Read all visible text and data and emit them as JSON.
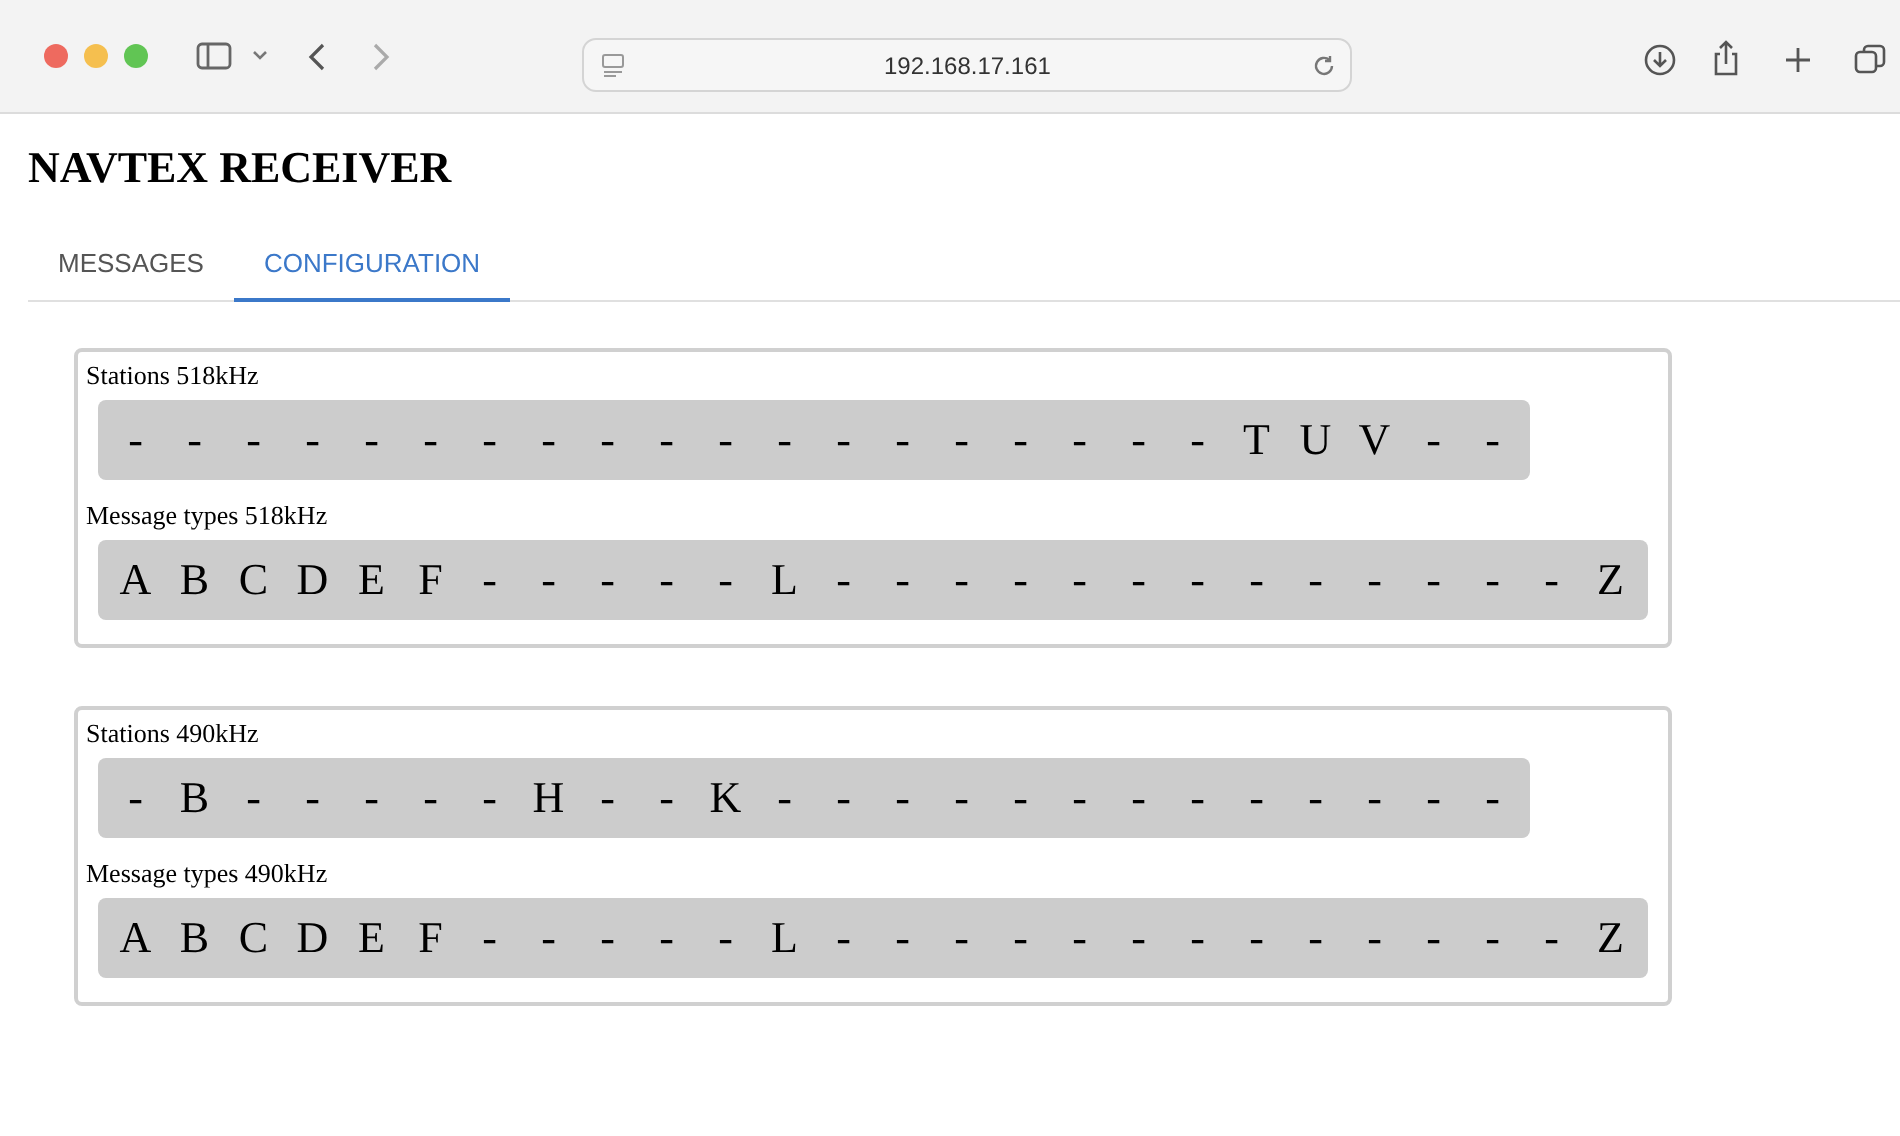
{
  "browser": {
    "address": "192.168.17.161"
  },
  "page": {
    "title": "NAVTEX RECEIVER",
    "tabs": [
      {
        "label": "MESSAGES",
        "selected": false
      },
      {
        "label": "CONFIGURATION",
        "selected": true
      }
    ],
    "groups": [
      {
        "rows": [
          {
            "label": "Stations 518kHz",
            "slots": [
              "-",
              "-",
              "-",
              "-",
              "-",
              "-",
              "-",
              "-",
              "-",
              "-",
              "-",
              "-",
              "-",
              "-",
              "-",
              "-",
              "-",
              "-",
              "-",
              "T",
              "U",
              "V",
              "-",
              "-"
            ]
          },
          {
            "label": "Message types 518kHz",
            "slots": [
              "A",
              "B",
              "C",
              "D",
              "E",
              "F",
              "-",
              "-",
              "-",
              "-",
              "-",
              "L",
              "-",
              "-",
              "-",
              "-",
              "-",
              "-",
              "-",
              "-",
              "-",
              "-",
              "-",
              "-",
              "-",
              "Z"
            ]
          }
        ]
      },
      {
        "rows": [
          {
            "label": "Stations 490kHz",
            "slots": [
              "-",
              "B",
              "-",
              "-",
              "-",
              "-",
              "-",
              "H",
              "-",
              "-",
              "K",
              "-",
              "-",
              "-",
              "-",
              "-",
              "-",
              "-",
              "-",
              "-",
              "-",
              "-",
              "-",
              "-"
            ]
          },
          {
            "label": "Message types 490kHz",
            "slots": [
              "A",
              "B",
              "C",
              "D",
              "E",
              "F",
              "-",
              "-",
              "-",
              "-",
              "-",
              "L",
              "-",
              "-",
              "-",
              "-",
              "-",
              "-",
              "-",
              "-",
              "-",
              "-",
              "-",
              "-",
              "-",
              "Z"
            ]
          }
        ]
      }
    ]
  }
}
